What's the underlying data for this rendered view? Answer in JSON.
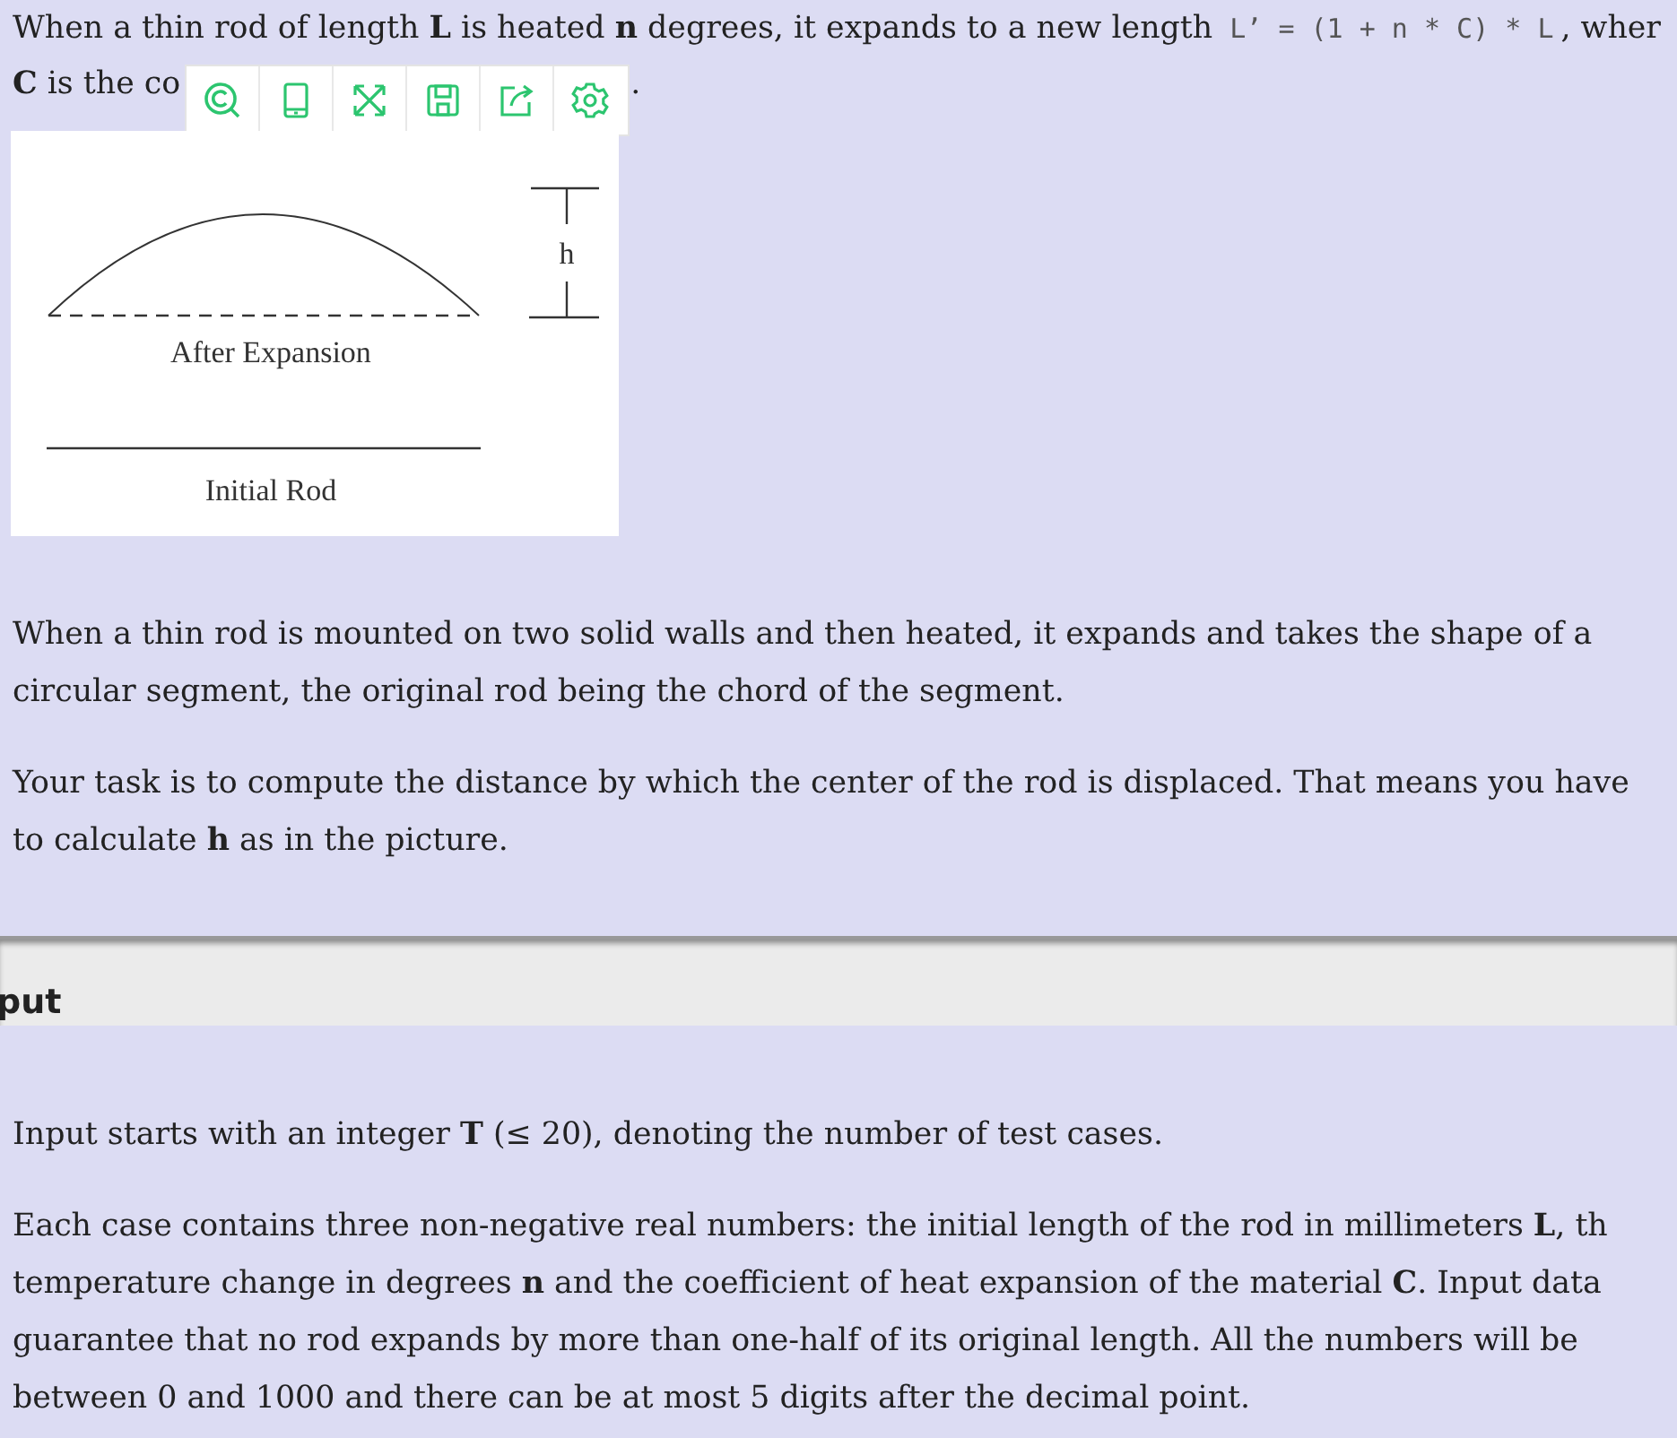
{
  "intro": {
    "line_1": [
      {
        "kind": "text",
        "text": "When a thin rod of length **L** is heated **n** degrees, it expands to a new length "
      },
      {
        "kind": "mono",
        "text": "L’ = (1 + n * C) * L"
      },
      {
        "kind": "text",
        "text": ", wher"
      }
    ],
    "line_2_start": "**C** is the co",
    "line_2_end": "."
  },
  "toolbar": {
    "buttons": [
      {
        "kind": "lens"
      },
      {
        "kind": "tablet"
      },
      {
        "kind": "expand"
      },
      {
        "kind": "save"
      },
      {
        "kind": "share"
      },
      {
        "kind": "settings"
      }
    ]
  },
  "figure": {
    "height_label": "h",
    "arc_label": "After Expansion",
    "rod_label": "Initial Rod"
  },
  "paragraphs": [
    [
      "When a thin rod is mounted on two solid walls and then heated, it expands and takes the shape of a",
      "circular segment, the original rod being the chord of the segment."
    ],
    [
      "Your task is to compute the distance by which the center of the rod is displaced. That means you have",
      "to calculate **h** as in the picture."
    ]
  ],
  "section": {
    "heading": "put"
  },
  "input_paragraphs": [
    [
      "Input starts with an integer **T** (≤ 20), denoting the number of test cases."
    ],
    [
      "Each case contains three non-negative real numbers: the initial length of the rod in millimeters **L**, th",
      "temperature change in degrees **n** and the coefficient of heat expansion of the material **C**. Input data",
      "guarantee that no rod expands by more than one-half of its original length. All the numbers will be",
      "between 0 and 1000 and there can be at most 5 digits after the decimal point."
    ]
  ]
}
